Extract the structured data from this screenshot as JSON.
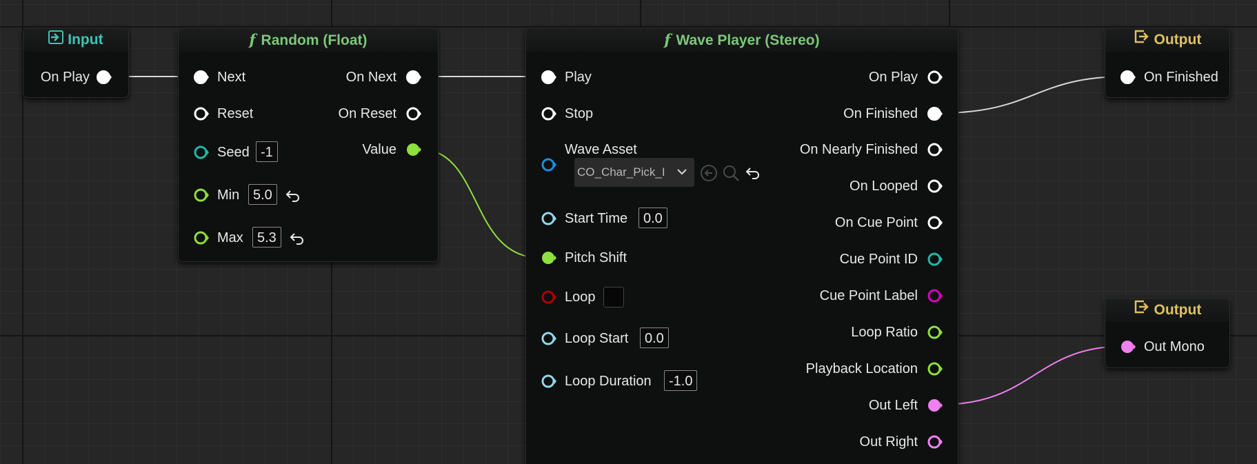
{
  "colors": {
    "exec": "#ffffff",
    "int": "#1fb8a8",
    "float": "#8ee03c",
    "object": "#1a8fe0",
    "time": "#8fd8e8",
    "bool": "#b00000",
    "audio": "#f080f0",
    "string": "#d600c0",
    "header_input": "#3fc2b8",
    "header_function": "#7cc87a",
    "header_output": "#e0c060"
  },
  "input_node": {
    "title": "Input",
    "icon": "input-arrow-icon",
    "pins": {
      "on_play": "On Play"
    }
  },
  "random_node": {
    "title": "Random (Float)",
    "icon": "function-icon",
    "pins": {
      "next": "Next",
      "reset": "Reset",
      "seed": "Seed",
      "min": "Min",
      "max": "Max",
      "on_next": "On Next",
      "on_reset": "On Reset",
      "value": "Value"
    },
    "values": {
      "seed": "-1",
      "min": "5.0",
      "max": "5.3"
    }
  },
  "wave_node": {
    "title": "Wave Player (Stereo)",
    "icon": "function-icon",
    "inputs": {
      "play": "Play",
      "stop": "Stop",
      "wave_asset": "Wave Asset",
      "start_time": "Start Time",
      "pitch_shift": "Pitch Shift",
      "loop": "Loop",
      "loop_start": "Loop Start",
      "loop_duration": "Loop Duration"
    },
    "values": {
      "wave_asset": "CO_Char_Pick_I",
      "start_time": "0.0",
      "loop_start": "0.0",
      "loop_duration": "-1.0"
    },
    "outputs": {
      "on_play": "On Play",
      "on_finished": "On Finished",
      "on_nearly_finished": "On Nearly Finished",
      "on_looped": "On Looped",
      "on_cue_point": "On Cue Point",
      "cue_point_id": "Cue Point ID",
      "cue_point_label": "Cue Point Label",
      "loop_ratio": "Loop Ratio",
      "playback_location": "Playback Location",
      "out_left": "Out Left",
      "out_right": "Out Right"
    }
  },
  "output_node_1": {
    "title": "Output",
    "icon": "output-arrow-icon",
    "pins": {
      "on_finished": "On Finished"
    }
  },
  "output_node_2": {
    "title": "Output",
    "icon": "output-arrow-icon",
    "pins": {
      "out_mono": "Out Mono"
    }
  }
}
